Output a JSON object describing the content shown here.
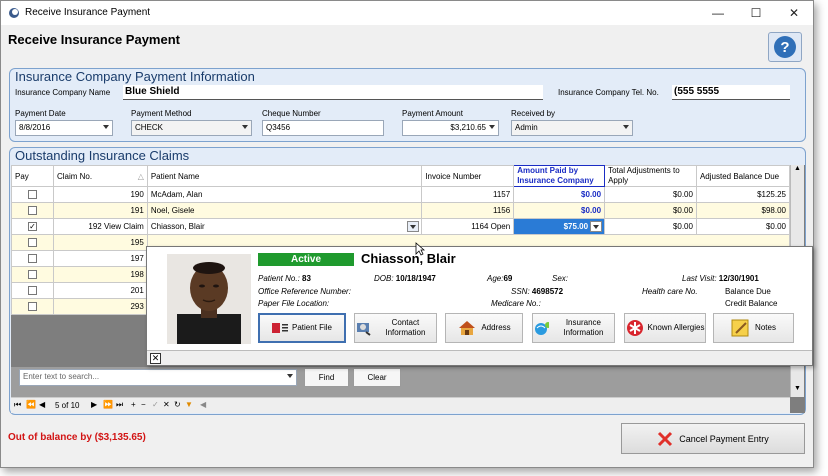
{
  "window": {
    "title": "Receive Insurance Payment"
  },
  "page_title": "Receive Insurance Payment",
  "help_icon": "question-icon",
  "payment_info": {
    "title": "Insurance Company Payment Information",
    "company_label": "Insurance Company Name",
    "company_value": "Blue Shield",
    "tel_label": "Insurance Company Tel. No.",
    "tel_value": "(555 5555",
    "payment_date_label": "Payment Date",
    "payment_date": "8/8/2016",
    "method_label": "Payment Method",
    "method": "CHECK",
    "cheque_label": "Cheque Number",
    "cheque": "Q3456",
    "amount_label": "Payment Amount",
    "amount": "$3,210.65",
    "received_label": "Received by",
    "received": "Admin"
  },
  "claims": {
    "title": "Outstanding Insurance Claims",
    "headers": {
      "pay": "Pay",
      "claim": "Claim No.",
      "patient": "Patient Name",
      "invoice": "Invoice Number",
      "amount_paid": "Amount Paid by Insurance Company",
      "adjust": "Total Adjustments to Apply",
      "balance": "Adjusted Balance Due"
    },
    "rows": [
      {
        "claim": "190",
        "patient": "McAdam, Alan",
        "invoice": "1157",
        "paid": "$0.00",
        "adjust": "$0.00",
        "balance": "$125.25"
      },
      {
        "claim": "191",
        "patient": "Noel, Gisele",
        "invoice": "1156",
        "paid": "$0.00",
        "adjust": "$0.00",
        "balance": "$98.00"
      },
      {
        "claim": "192",
        "view": "View Claim",
        "patient": "Chiasson, Blair",
        "invoice": "1164",
        "open": "Open",
        "paid": "$75.00",
        "adjust": "$0.00",
        "balance": "$0.00"
      },
      {
        "claim": "195"
      },
      {
        "claim": "197"
      },
      {
        "claim": "198"
      },
      {
        "claim": "201"
      },
      {
        "claim": "293"
      }
    ]
  },
  "patient_popup": {
    "status": "Active",
    "name": "Chiasson, Blair",
    "patient_no_label": "Patient No.:",
    "patient_no": "83",
    "dob_label": "DOB:",
    "dob": "10/18/1947",
    "age_label": "Age:",
    "age": "69",
    "sex_label": "Sex:",
    "last_visit_label": "Last Visit:",
    "last_visit": "12/30/1901",
    "office_ref_label": "Office Reference Number:",
    "ssn_label": "SSN:",
    "ssn": "4698572",
    "health_card_label": "Health care No.",
    "balance_due_label": "Balance Due",
    "paper_file_label": "Paper File Location:",
    "medicare_label": "Medicare No.:",
    "credit_balance_label": "Credit Balance",
    "buttons": {
      "patient_file": "Patient File",
      "contact": "Contact Information",
      "address": "Address",
      "insurance": "Insurance Information",
      "allergies": "Known Allergies",
      "notes": "Notes"
    }
  },
  "search": {
    "placeholder": "Enter text to search...",
    "find": "Find",
    "clear": "Clear"
  },
  "pager": {
    "text": "5 of 10"
  },
  "footer": {
    "out_of_balance": "Out of balance by ($3,135.65)",
    "cancel": "Cancel Payment Entry"
  }
}
